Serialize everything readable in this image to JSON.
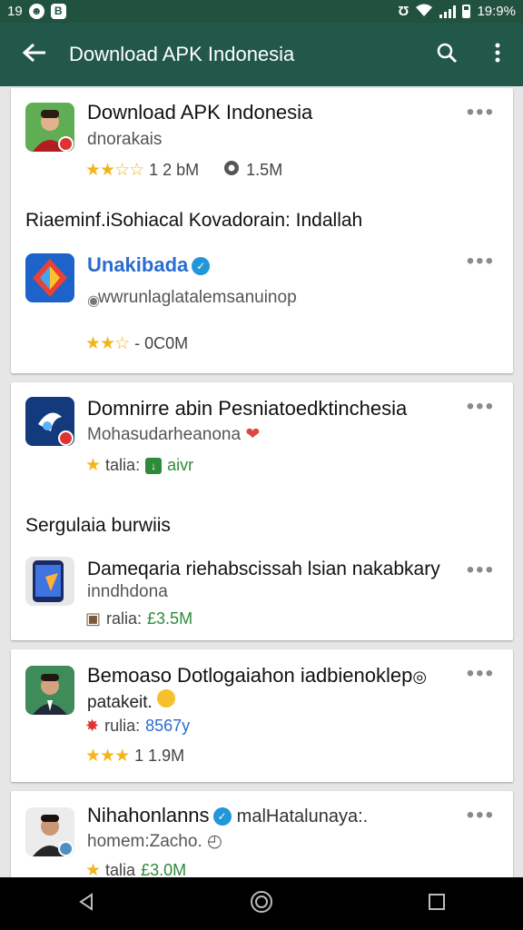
{
  "statusbar": {
    "left_time": "19",
    "right_time": "19:9%"
  },
  "appbar": {
    "title": "Download APK Indonesia"
  },
  "cards": [
    {
      "header_item": {
        "name": "Download APK Indonesia",
        "sub": "dnorakais",
        "rating_count": "1 2 bM",
        "comments": "1.5M"
      },
      "section_title": "Riaeminf.iSohiacal Kovadorain: Indallah",
      "second_item": {
        "name": "Unakibada",
        "sub": "wwrunlaglatalemsanuinop",
        "rating_count": "- 0C0M"
      }
    },
    {
      "header_item": {
        "name": "Domnirre abin Pesniatoedktinchesia",
        "sub": "Mohasudarheanona",
        "label": "talia:",
        "value": "aivr"
      },
      "section_title": "Sergulaia burwiis",
      "second_item": {
        "name": "Dameqaria riehabscissah lsian nakabkary",
        "sub": "inndhdona",
        "label": "ralia:",
        "value": "£3.5M"
      }
    },
    {
      "header_item": {
        "name": "Bemoaso Dotlogaiahon iadbienoklep",
        "sub": "patakeit.",
        "label": "rulia:",
        "value": "8567y",
        "rating_count": "1 1.9M"
      }
    },
    {
      "header_item": {
        "name": "Nihahonlanns",
        "name_extra": "malHatalunaya:.",
        "sub": "homem:Zacho.",
        "label": "talia",
        "value": "£3.0M"
      }
    }
  ]
}
